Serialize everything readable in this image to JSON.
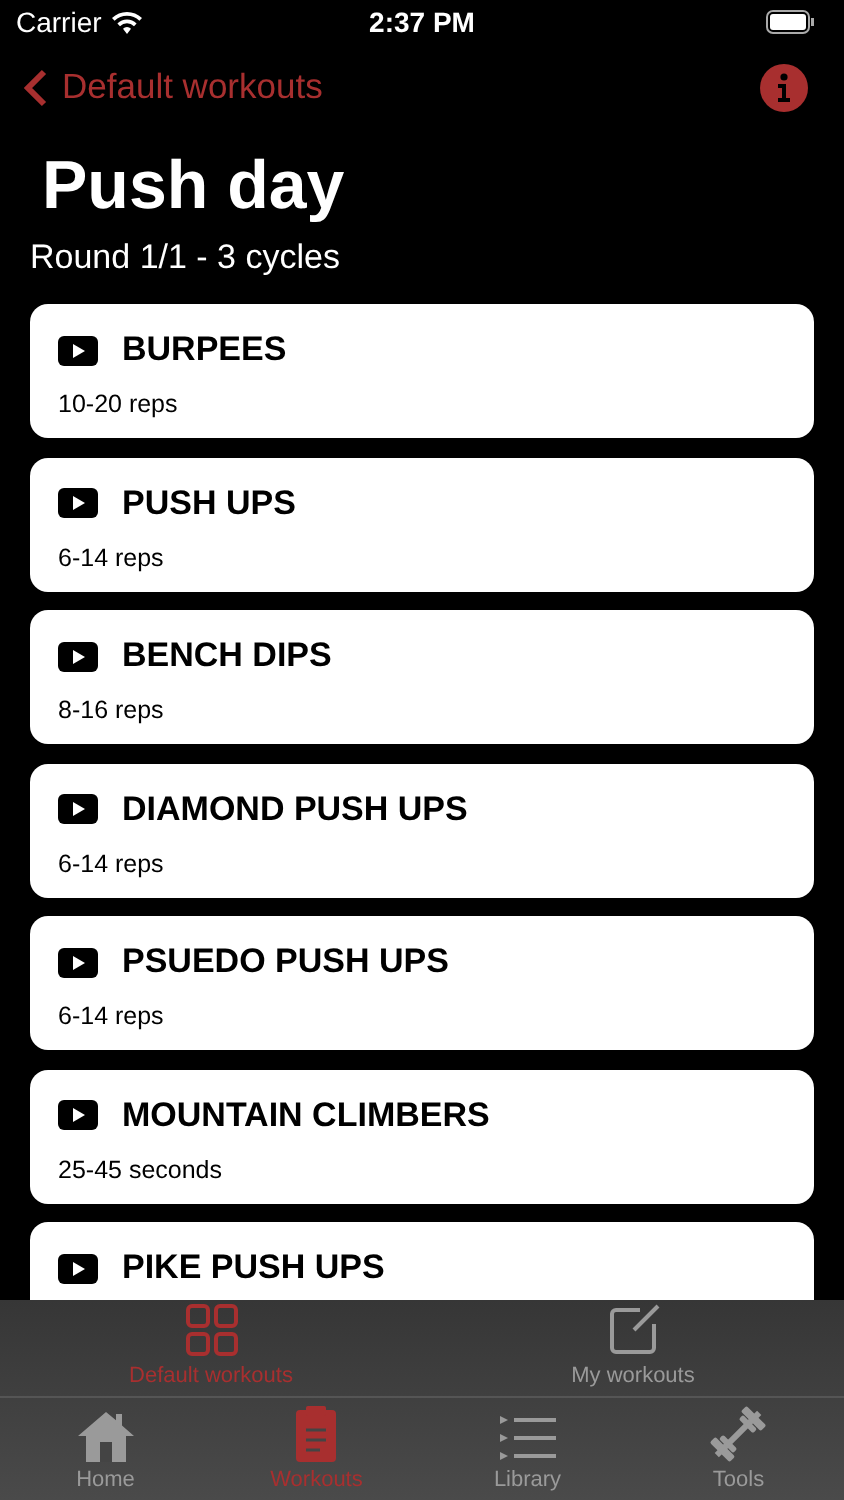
{
  "status_bar": {
    "carrier": "Carrier",
    "time": "2:37 PM"
  },
  "nav": {
    "back_label": "Default workouts"
  },
  "title": "Push day",
  "subtitle": "Round 1/1 - 3 cycles",
  "exercises": [
    {
      "name": "BURPEES",
      "reps": "10-20 reps"
    },
    {
      "name": "PUSH UPS",
      "reps": "6-14 reps"
    },
    {
      "name": "BENCH DIPS",
      "reps": "8-16 reps"
    },
    {
      "name": "DIAMOND PUSH UPS",
      "reps": "6-14 reps"
    },
    {
      "name": "PSUEDO PUSH UPS",
      "reps": "6-14 reps"
    },
    {
      "name": "MOUNTAIN CLIMBERS",
      "reps": "25-45 seconds"
    },
    {
      "name": "PIKE PUSH UPS"
    }
  ],
  "segment_tabs": [
    {
      "kind": "grid",
      "label": "Default workouts",
      "selected": true
    },
    {
      "kind": "edit",
      "label": "My workouts",
      "selected": false
    }
  ],
  "tab_bar": [
    {
      "kind": "home",
      "label": "Home",
      "selected": false
    },
    {
      "kind": "clipboard",
      "label": "Workouts",
      "selected": true
    },
    {
      "kind": "list",
      "label": "Library",
      "selected": false
    },
    {
      "kind": "dumbbell",
      "label": "Tools",
      "selected": false
    }
  ]
}
